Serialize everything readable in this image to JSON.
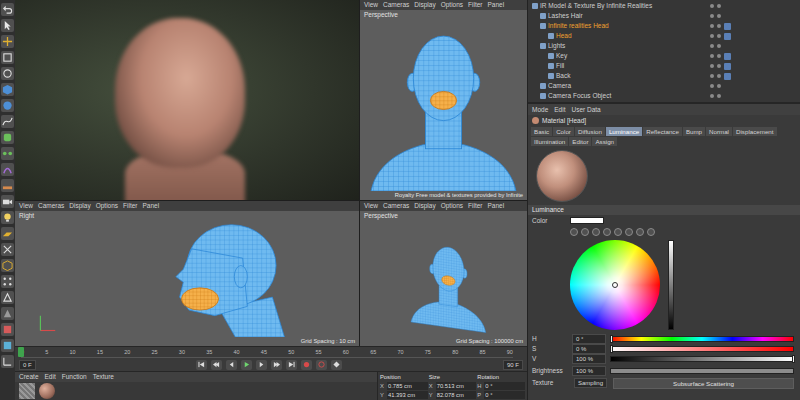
{
  "viewports": [
    {
      "kind": "render"
    },
    {
      "kind": "front",
      "menu": [
        "View",
        "Cameras",
        "Display",
        "Options",
        "Filter",
        "Panel"
      ],
      "label": "Perspective",
      "footer": "Royalty Free model & textures provided by Infinite"
    },
    {
      "kind": "side",
      "menu": [
        "View",
        "Cameras",
        "Display",
        "Options",
        "Filter",
        "Panel"
      ],
      "label": "Right",
      "footer": "Grid Spacing : 10 cm"
    },
    {
      "kind": "persp",
      "menu": [
        "View",
        "Cameras",
        "Display",
        "Options",
        "Filter",
        "Panel"
      ],
      "label": "Perspective",
      "footer": "Grid Spacing : 100000 cm"
    }
  ],
  "timeline": {
    "ticks": [
      "0",
      "5",
      "10",
      "15",
      "20",
      "25",
      "30",
      "35",
      "40",
      "45",
      "50",
      "55",
      "60",
      "65",
      "70",
      "75",
      "80",
      "85",
      "90"
    ],
    "level": 0,
    "start": "0 F",
    "end": "90 F"
  },
  "materials": {
    "menu": [
      "Create",
      "Edit",
      "Function",
      "Texture"
    ]
  },
  "coordinates": {
    "headers": [
      "Position",
      "Size",
      "Rotation"
    ],
    "rows": [
      [
        "X",
        "0.785 cm",
        "X",
        "70.513 cm",
        "H",
        "0 °"
      ],
      [
        "Y",
        "41.393 cm",
        "Y",
        "82.078 cm",
        "P",
        "0 °"
      ]
    ]
  },
  "objects": [
    {
      "name": "IR Model & Texture By Infinite Realities",
      "depth": 0,
      "selected": false
    },
    {
      "name": "Lashes Hair",
      "depth": 1,
      "selected": false
    },
    {
      "name": "Infinite realities Head",
      "depth": 1,
      "selected": true
    },
    {
      "name": "Head",
      "depth": 2,
      "selected": true
    },
    {
      "name": "Lights",
      "depth": 1,
      "selected": false
    },
    {
      "name": "Key",
      "depth": 2,
      "selected": false
    },
    {
      "name": "Fill",
      "depth": 2,
      "selected": false
    },
    {
      "name": "Back",
      "depth": 2,
      "selected": false
    },
    {
      "name": "Camera",
      "depth": 1,
      "selected": false
    },
    {
      "name": "Camera Focus Object",
      "depth": 1,
      "selected": false
    }
  ],
  "attributes": {
    "menu": [
      "Mode",
      "Edit",
      "User Data"
    ],
    "title": "Material [Head]",
    "tabs": [
      {
        "label": "Basic",
        "selected": false
      },
      {
        "label": "Color",
        "selected": false
      },
      {
        "label": "Diffusion",
        "selected": false
      },
      {
        "label": "Luminance",
        "selected": true
      },
      {
        "label": "Reflectance",
        "selected": false
      },
      {
        "label": "Bump",
        "selected": false
      },
      {
        "label": "Normal",
        "selected": false
      },
      {
        "label": "Displacement",
        "selected": false
      },
      {
        "label": "Illumination",
        "selected": false
      },
      {
        "label": "Editor",
        "selected": false
      },
      {
        "label": "Assign",
        "selected": false
      }
    ],
    "section": "Luminance",
    "color_label": "Color",
    "sliders": [
      {
        "label": "H",
        "reading": "0 °",
        "level": 0,
        "kind": "hue"
      },
      {
        "label": "S",
        "reading": "0 %",
        "level": 0,
        "kind": "sat"
      },
      {
        "label": "V",
        "reading": "100 %",
        "level": 1,
        "kind": "val"
      }
    ],
    "brightness": {
      "label": "Brightness",
      "reading": "100 %",
      "level": 1
    },
    "texture": {
      "label": "Texture",
      "mode": "Subsurface Scattering",
      "sampling": "Sampling"
    }
  }
}
